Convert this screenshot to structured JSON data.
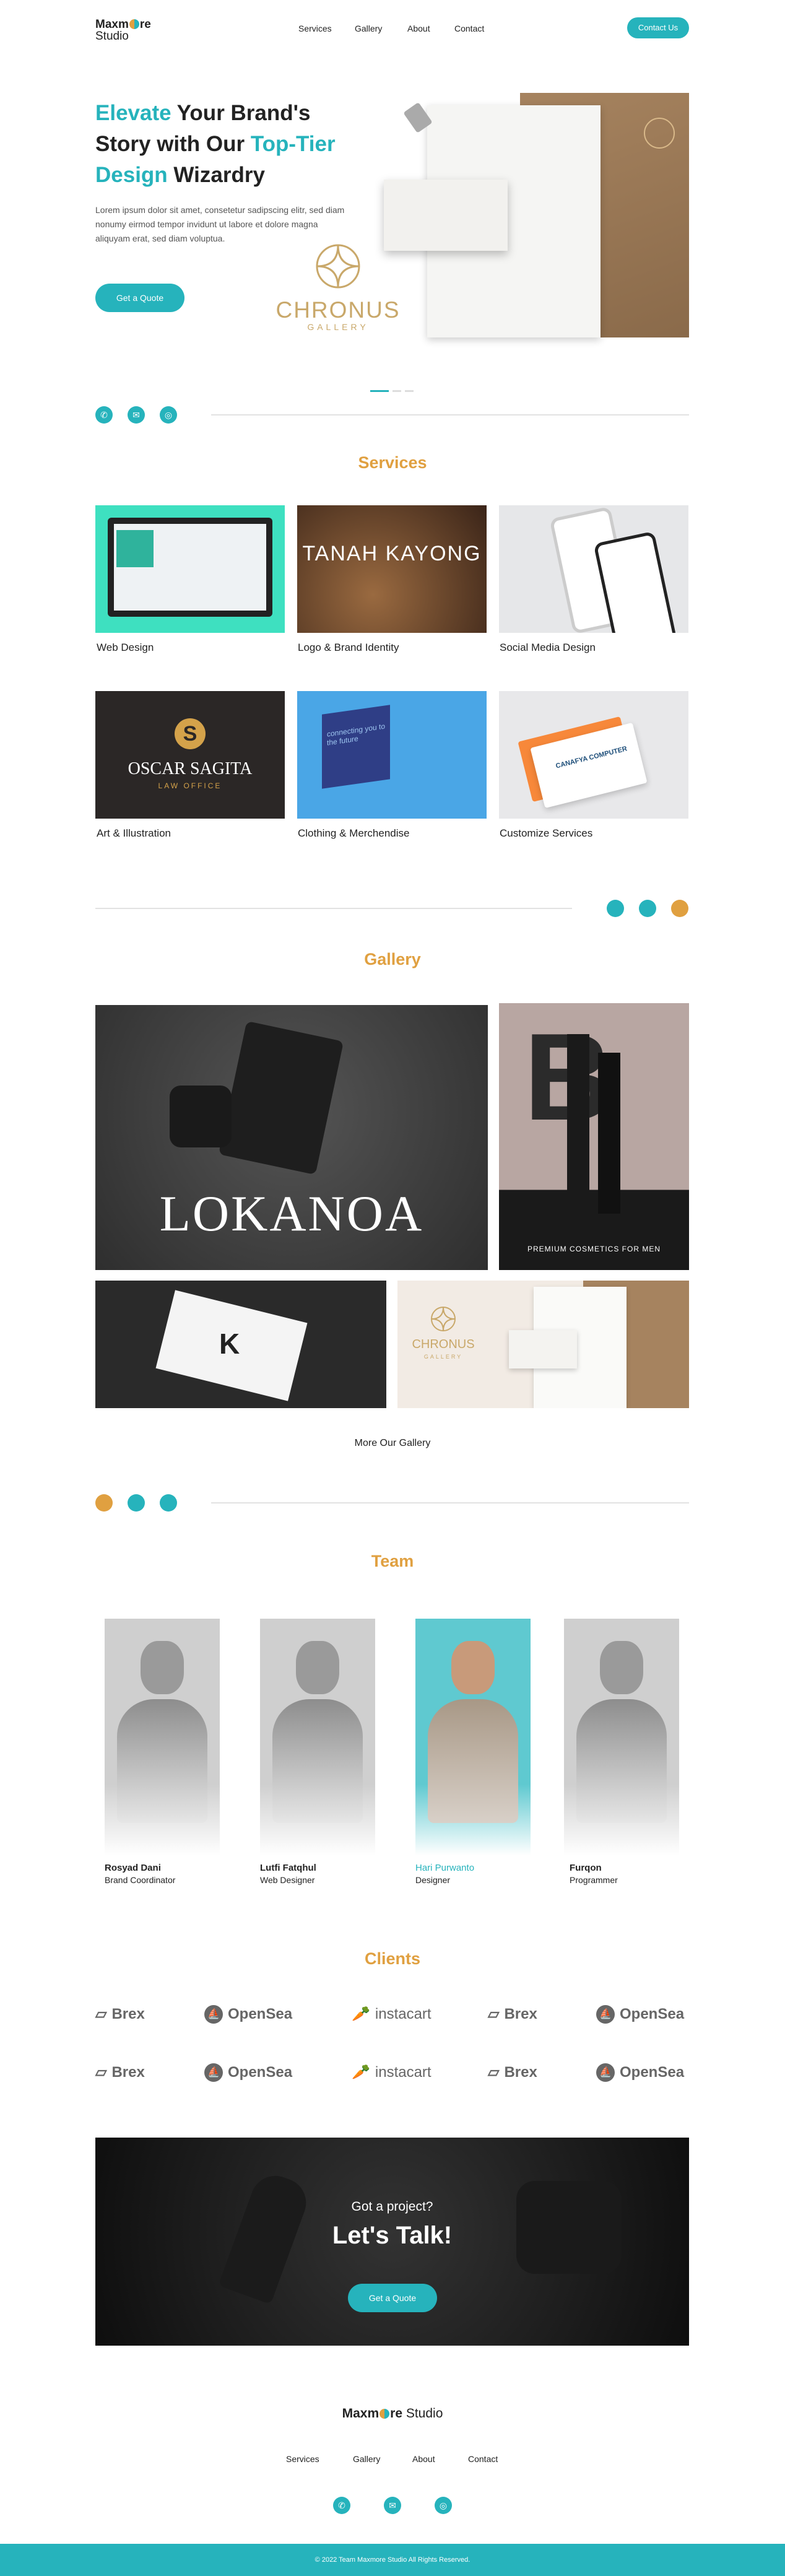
{
  "header": {
    "logo_top": "Maxm",
    "logo_top_end": "re",
    "logo_bottom": "Studio",
    "nav": [
      "Services",
      "Gallery",
      "About",
      "Contact"
    ],
    "cta": "Contact Us"
  },
  "hero": {
    "title_parts": [
      "Elevate",
      " Your Brand's Story with Our ",
      "Top-Tier Design",
      " Wizardry"
    ],
    "description": "Lorem ipsum dolor sit amet, consetetur sadipscing elitr, sed diam nonumy eirmod tempor invidunt ut labore et dolore magna aliquyam erat, sed diam voluptua.",
    "cta": "Get a Quote",
    "brand_name": "CHRONUS",
    "brand_sub": "GALLERY"
  },
  "social_icons": [
    "phone-icon",
    "mail-icon",
    "instagram-icon"
  ],
  "services": {
    "title": "Services",
    "items": [
      {
        "label": "Web Design",
        "art": ""
      },
      {
        "label": "Logo & Brand Identity",
        "art": "TANAH KAYONG"
      },
      {
        "label": "Social Media Design",
        "art": ""
      },
      {
        "label": "Art & Illustration",
        "art": "OSCAR SAGITA",
        "art_sub": "LAW OFFICE"
      },
      {
        "label": "Clothing & Merchendise",
        "art": "connecting you to the future"
      },
      {
        "label": "Customize Services",
        "art": "CANAFYA COMPUTER"
      }
    ]
  },
  "gallery": {
    "title": "Gallery",
    "lokanoa": "LOKANOA",
    "cosmetics": "PREMIUM COSMETICS FOR MEN",
    "chronus": "CHRONUS",
    "chronus_sub": "GALLERY",
    "more": "More Our Gallery"
  },
  "team": {
    "title": "Team",
    "members": [
      {
        "name": "Rosyad Dani",
        "role": "Brand Coordinator"
      },
      {
        "name": "Lutfi Fatqhul",
        "role": "Web Designer"
      },
      {
        "name": "Hari Purwanto",
        "role": "Designer"
      },
      {
        "name": "Furqon",
        "role": "Programmer"
      }
    ]
  },
  "clients": {
    "title": "Clients",
    "row1": [
      "Brex",
      "OpenSea",
      "instacart",
      "Brex",
      "OpenSea"
    ],
    "row2": [
      "Brex",
      "OpenSea",
      "instacart",
      "Brex",
      "OpenSea"
    ]
  },
  "cta": {
    "kicker": "Got a project?",
    "title": "Let's Talk!",
    "button": "Get a Quote"
  },
  "footer": {
    "nav": [
      "Services",
      "Gallery",
      "About",
      "Contact"
    ],
    "copyright": "© 2022 Team Maxmore Studio All Rights Reserved."
  },
  "colors": {
    "accent": "#26b3bc",
    "secondary": "#e0a040"
  }
}
